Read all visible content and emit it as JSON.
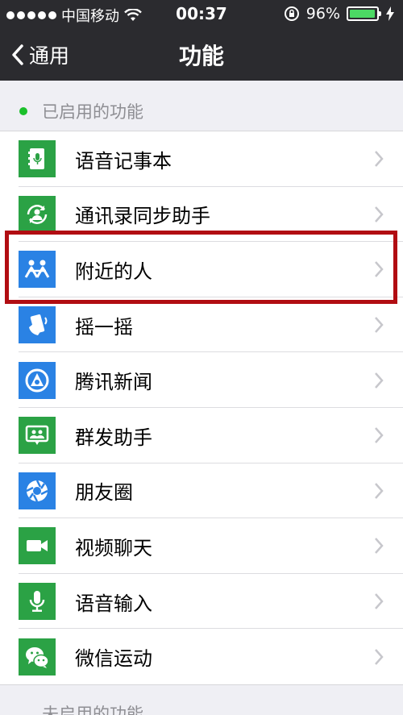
{
  "status_bar": {
    "carrier": "中国移动",
    "time": "00:37",
    "battery_percent": "96%",
    "battery_level": 0.96
  },
  "nav": {
    "back_label": "通用",
    "title": "功能"
  },
  "section_enabled": {
    "title": "已启用的功能"
  },
  "features": [
    {
      "label": "语音记事本",
      "icon": "voice-notepad-icon",
      "color": "#2ba245"
    },
    {
      "label": "通讯录同步助手",
      "icon": "contacts-sync-icon",
      "color": "#2ba245"
    },
    {
      "label": "附近的人",
      "icon": "people-nearby-icon",
      "color": "#2a82e4"
    },
    {
      "label": "摇一摇",
      "icon": "shake-icon",
      "color": "#2a82e4"
    },
    {
      "label": "腾讯新闻",
      "icon": "tencent-news-icon",
      "color": "#2a82e4"
    },
    {
      "label": "群发助手",
      "icon": "broadcast-icon",
      "color": "#2ba245"
    },
    {
      "label": "朋友圈",
      "icon": "moments-icon",
      "color": "#2a82e4"
    },
    {
      "label": "视频聊天",
      "icon": "video-chat-icon",
      "color": "#2ba245"
    },
    {
      "label": "语音输入",
      "icon": "voice-input-icon",
      "color": "#2ba245"
    },
    {
      "label": "微信运动",
      "icon": "wechat-sport-icon",
      "color": "#2ba245"
    }
  ],
  "section_disabled": {
    "title": "未启用的功能"
  }
}
